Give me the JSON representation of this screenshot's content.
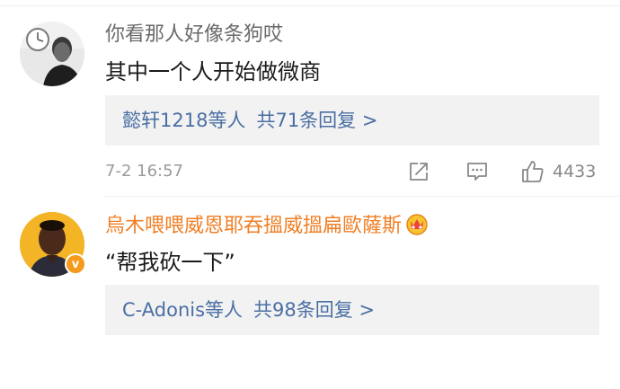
{
  "comments": [
    {
      "username": "你看那人好像条狗哎",
      "text": "其中一个人开始做微商",
      "replies": {
        "names": "懿轩1218",
        "suffix": "等人",
        "count_text": "共71条回复 >"
      },
      "timestamp": "7-2 16:57",
      "like_count": "4433",
      "avatar_icon": "profile-photo",
      "actions": [
        "share-icon",
        "comment-icon",
        "like-icon"
      ]
    },
    {
      "username": "烏木喂喂威恩耶吞搵威搵扁歐薩斯",
      "text": "“帮我砍一下”",
      "replies": {
        "names": "C-Adonis",
        "suffix": "等人",
        "count_text": "共98条回复 >"
      },
      "verified_mark": "v",
      "avatar_icon": "profile-photo",
      "badge_icon": "crown-icon"
    }
  ],
  "colors": {
    "username_gray": "#6a6a6a",
    "username_orange": "#f07e24",
    "link_blue": "#4a6fa3",
    "reply_bg": "#f2f2f2",
    "meta_gray": "#9a9a9a"
  }
}
